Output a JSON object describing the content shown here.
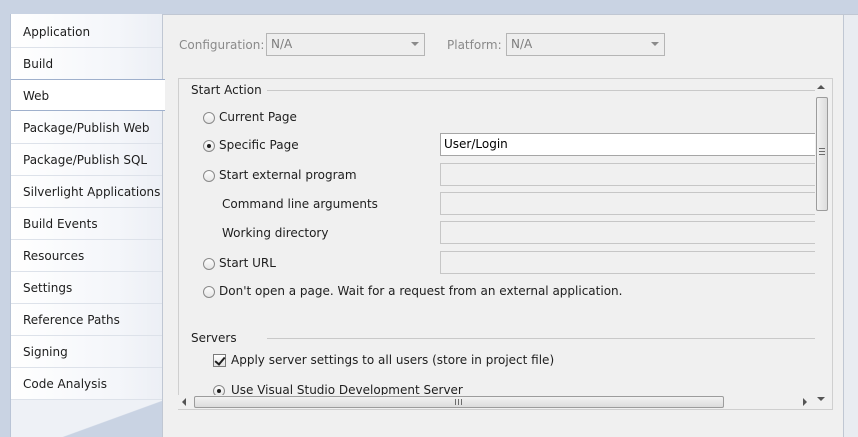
{
  "sidebar": {
    "items": [
      {
        "label": "Application"
      },
      {
        "label": "Build"
      },
      {
        "label": "Web",
        "selected": true
      },
      {
        "label": "Package/Publish Web"
      },
      {
        "label": "Package/Publish SQL"
      },
      {
        "label": "Silverlight Applications"
      },
      {
        "label": "Build Events"
      },
      {
        "label": "Resources"
      },
      {
        "label": "Settings"
      },
      {
        "label": "Reference Paths"
      },
      {
        "label": "Signing"
      },
      {
        "label": "Code Analysis"
      }
    ]
  },
  "config": {
    "configuration_label": "Configuration:",
    "configuration_value": "N/A",
    "platform_label": "Platform:",
    "platform_value": "N/A"
  },
  "start_action": {
    "title": "Start Action",
    "current_page": "Current Page",
    "specific_page": "Specific Page",
    "specific_page_value": "User/Login",
    "external_program": "Start external program",
    "command_line_arguments": "Command line arguments",
    "working_directory": "Working directory",
    "start_url": "Start URL",
    "dont_open": "Don't open a page.  Wait for a request from an external application.",
    "selected": "specific_page"
  },
  "servers": {
    "title": "Servers",
    "apply_settings": "Apply server settings to all users (store in project file)",
    "apply_settings_checked": true,
    "vs_dev_server": "Use Visual Studio Development Server"
  },
  "colors": {
    "background": "#c9d3e3",
    "panel": "#f0f0f0",
    "sidebar": "#ffffff"
  }
}
